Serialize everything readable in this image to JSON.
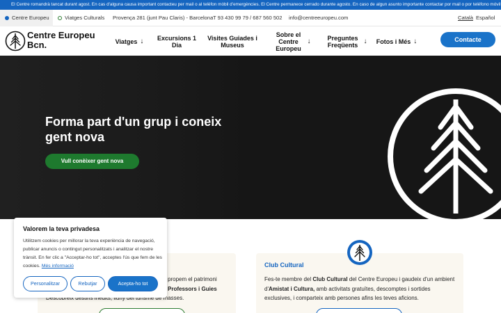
{
  "announcement": "El Centre romandrà tancat durant agost. En cas d'alguna causa important contacteu per mail o al telèfon mòbil d'emergències. El Centre permanece cerrado durante agosto. En caso de algun asunto importante contactar por mail o por teléfono móvil de emergencias.",
  "topbar": {
    "tabs": [
      "Centre Europeu",
      "Viatges Culturals"
    ],
    "address": "Provença 281 (junt Pau Claris) - Barcelona",
    "phone": "T 93 430 99 79 / 687 560 502",
    "email": "info@centreeuropeu.com",
    "languages": [
      "Català",
      "Español"
    ]
  },
  "header": {
    "logo_text": "Centre Europeu Bcn.",
    "nav": [
      {
        "label": "Viatges",
        "arrow": "↓"
      },
      {
        "label": "Excursions 1 Dia",
        "arrow": ""
      },
      {
        "label": "Visites Guiades i Museus",
        "arrow": ""
      },
      {
        "label": "Sobre el Centre Europeu",
        "arrow": "↓"
      },
      {
        "label": "Preguntes Freqüents",
        "arrow": "↓"
      },
      {
        "label": "Fotos i Més",
        "arrow": "↓"
      }
    ],
    "contact_label": "Contacte"
  },
  "hero": {
    "title": "Forma part d'un grup i coneix gent nova",
    "button_label": "Vull conèixer gent nova"
  },
  "cards": [
    {
      "title": "",
      "text_parts": [
        "",
        "propem el patrimoni",
        "",
        "Professors i Guies",
        "",
        "Descobreix destins inèdits, lluny del turisme de masses."
      ]
    },
    {
      "title": "Club Cultural",
      "text_parts": [
        "Fes-te membre del ",
        "Club Cultural",
        " del Centre Europeu i gaudeix d'un ambient d'",
        "Amistat i Cultura,",
        " amb activitats gratuïtes, descomptes i sortides exclusives, i comparteix amb persones afins les teves aficions."
      ]
    }
  ],
  "cookie": {
    "title": "Valorem la teva privadesa",
    "text": "Utilitzem cookies per millorar la teva experiència de navegació, publicar anuncis o contingut personalitzats i analitzar el nostre trànsit. En fer clic a \"Acceptar-ho tot\", acceptes l'ús que fem de les cookies.",
    "link": "Més informació",
    "buttons": {
      "customize": "Personalitzar",
      "reject": "Rebutjar",
      "accept": "Acepta-ho tot"
    }
  },
  "colors": {
    "brand_blue": "#1a73c9",
    "brand_green": "#1e7a2e",
    "hero_bg": "#161616",
    "card_bg": "#faf7f0"
  },
  "icons": {
    "logo": "pine-tree-circle-icon",
    "hero": "pine-tree-circle-icon",
    "club": "pine-tree-badge-icon"
  }
}
